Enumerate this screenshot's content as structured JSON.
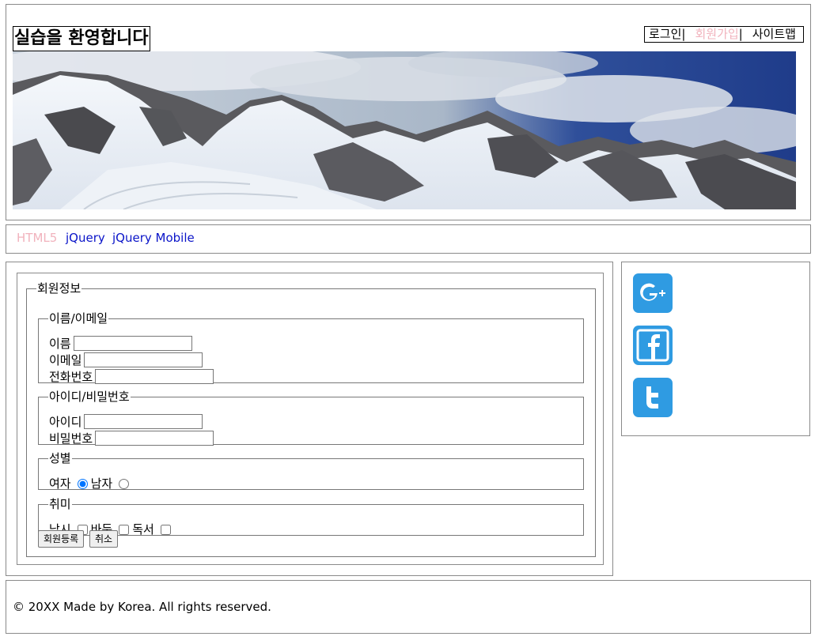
{
  "header": {
    "title": "실습을 환영합니다",
    "util_nav": {
      "login": "로그인",
      "join": "회원가입",
      "sitemap": "사이트맵",
      "separator": "|"
    },
    "banner_icon": "mountain-panorama-image"
  },
  "nav": {
    "items": [
      "HTML5",
      "jQuery",
      "jQuery Mobile"
    ],
    "current_color": "#f1b3bd",
    "link_color": "#0a14c8"
  },
  "form": {
    "legend": "회원정보",
    "name_email": {
      "legend": "이름/이메일",
      "name_label": "이름",
      "email_label": "이메일",
      "phone_label": "전화번호",
      "name_value": "",
      "email_value": "",
      "phone_value": ""
    },
    "account": {
      "legend": "아이디/비밀번호",
      "id_label": "아이디",
      "password_label": "비밀번호",
      "id_value": "",
      "password_value": ""
    },
    "gender": {
      "legend": "성별",
      "female_label": "여자",
      "male_label": "남자",
      "selected": "female"
    },
    "hobby": {
      "legend": "취미",
      "options": [
        "낚시",
        "바둑",
        "독서"
      ]
    },
    "submit_label": "회원등록",
    "cancel_label": "취소"
  },
  "aside": {
    "social": [
      {
        "icon": "google-plus-icon"
      },
      {
        "icon": "facebook-icon"
      },
      {
        "icon": "twitter-icon"
      }
    ],
    "icon_color": "#2f9be2"
  },
  "footer": {
    "text": "© 20XX Made by Korea. All rights reserved."
  }
}
